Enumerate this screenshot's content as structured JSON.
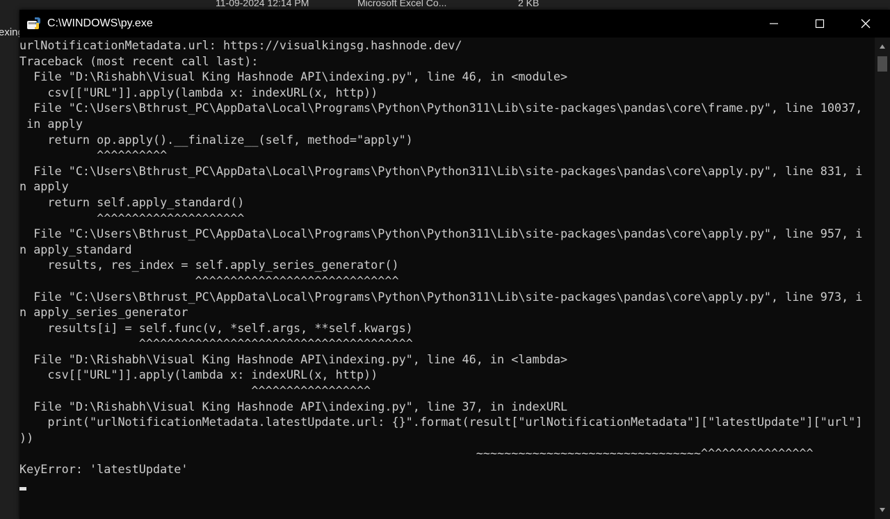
{
  "background": {
    "date_text": "11-09-2024 12:14 PM",
    "type_text": "Microsoft Excel Co...",
    "size_text": "2 KB",
    "left_text": "exing"
  },
  "window": {
    "title": "C:\\WINDOWS\\py.exe",
    "minimize_label": "minimize",
    "maximize_label": "maximize",
    "close_label": "close"
  },
  "console": {
    "lines": [
      "urlNotificationMetadata.url: https://visualkingsg.hashnode.dev/",
      "Traceback (most recent call last):",
      "  File \"D:\\Rishabh\\Visual King Hashnode API\\indexing.py\", line 46, in <module>",
      "    csv[[\"URL\"]].apply(lambda x: indexURL(x, http))",
      "  File \"C:\\Users\\Bthrust_PC\\AppData\\Local\\Programs\\Python\\Python311\\Lib\\site-packages\\pandas\\core\\frame.py\", line 10037,",
      " in apply",
      "    return op.apply().__finalize__(self, method=\"apply\")",
      "           ^^^^^^^^^^",
      "  File \"C:\\Users\\Bthrust_PC\\AppData\\Local\\Programs\\Python\\Python311\\Lib\\site-packages\\pandas\\core\\apply.py\", line 831, i",
      "n apply",
      "    return self.apply_standard()",
      "           ^^^^^^^^^^^^^^^^^^^^^",
      "  File \"C:\\Users\\Bthrust_PC\\AppData\\Local\\Programs\\Python\\Python311\\Lib\\site-packages\\pandas\\core\\apply.py\", line 957, i",
      "n apply_standard",
      "    results, res_index = self.apply_series_generator()",
      "                         ^^^^^^^^^^^^^^^^^^^^^^^^^^^^^",
      "  File \"C:\\Users\\Bthrust_PC\\AppData\\Local\\Programs\\Python\\Python311\\Lib\\site-packages\\pandas\\core\\apply.py\", line 973, i",
      "n apply_series_generator",
      "    results[i] = self.func(v, *self.args, **self.kwargs)",
      "                 ^^^^^^^^^^^^^^^^^^^^^^^^^^^^^^^^^^^^^^^",
      "  File \"D:\\Rishabh\\Visual King Hashnode API\\indexing.py\", line 46, in <lambda>",
      "    csv[[\"URL\"]].apply(lambda x: indexURL(x, http))",
      "                                 ^^^^^^^^^^^^^^^^^",
      "  File \"D:\\Rishabh\\Visual King Hashnode API\\indexing.py\", line 37, in indexURL",
      "    print(\"urlNotificationMetadata.latestUpdate.url: {}\".format(result[\"urlNotificationMetadata\"][\"latestUpdate\"][\"url\"]",
      "))",
      "                                                                 ~~~~~~~~~~~~~~~~~~~~~~~~~~~~~~~~^^^^^^^^^^^^^^^^",
      "KeyError: 'latestUpdate'"
    ]
  },
  "colors": {
    "console_bg": "#0c0c0c",
    "console_text": "#cccccc",
    "titlebar_bg": "#000000"
  }
}
